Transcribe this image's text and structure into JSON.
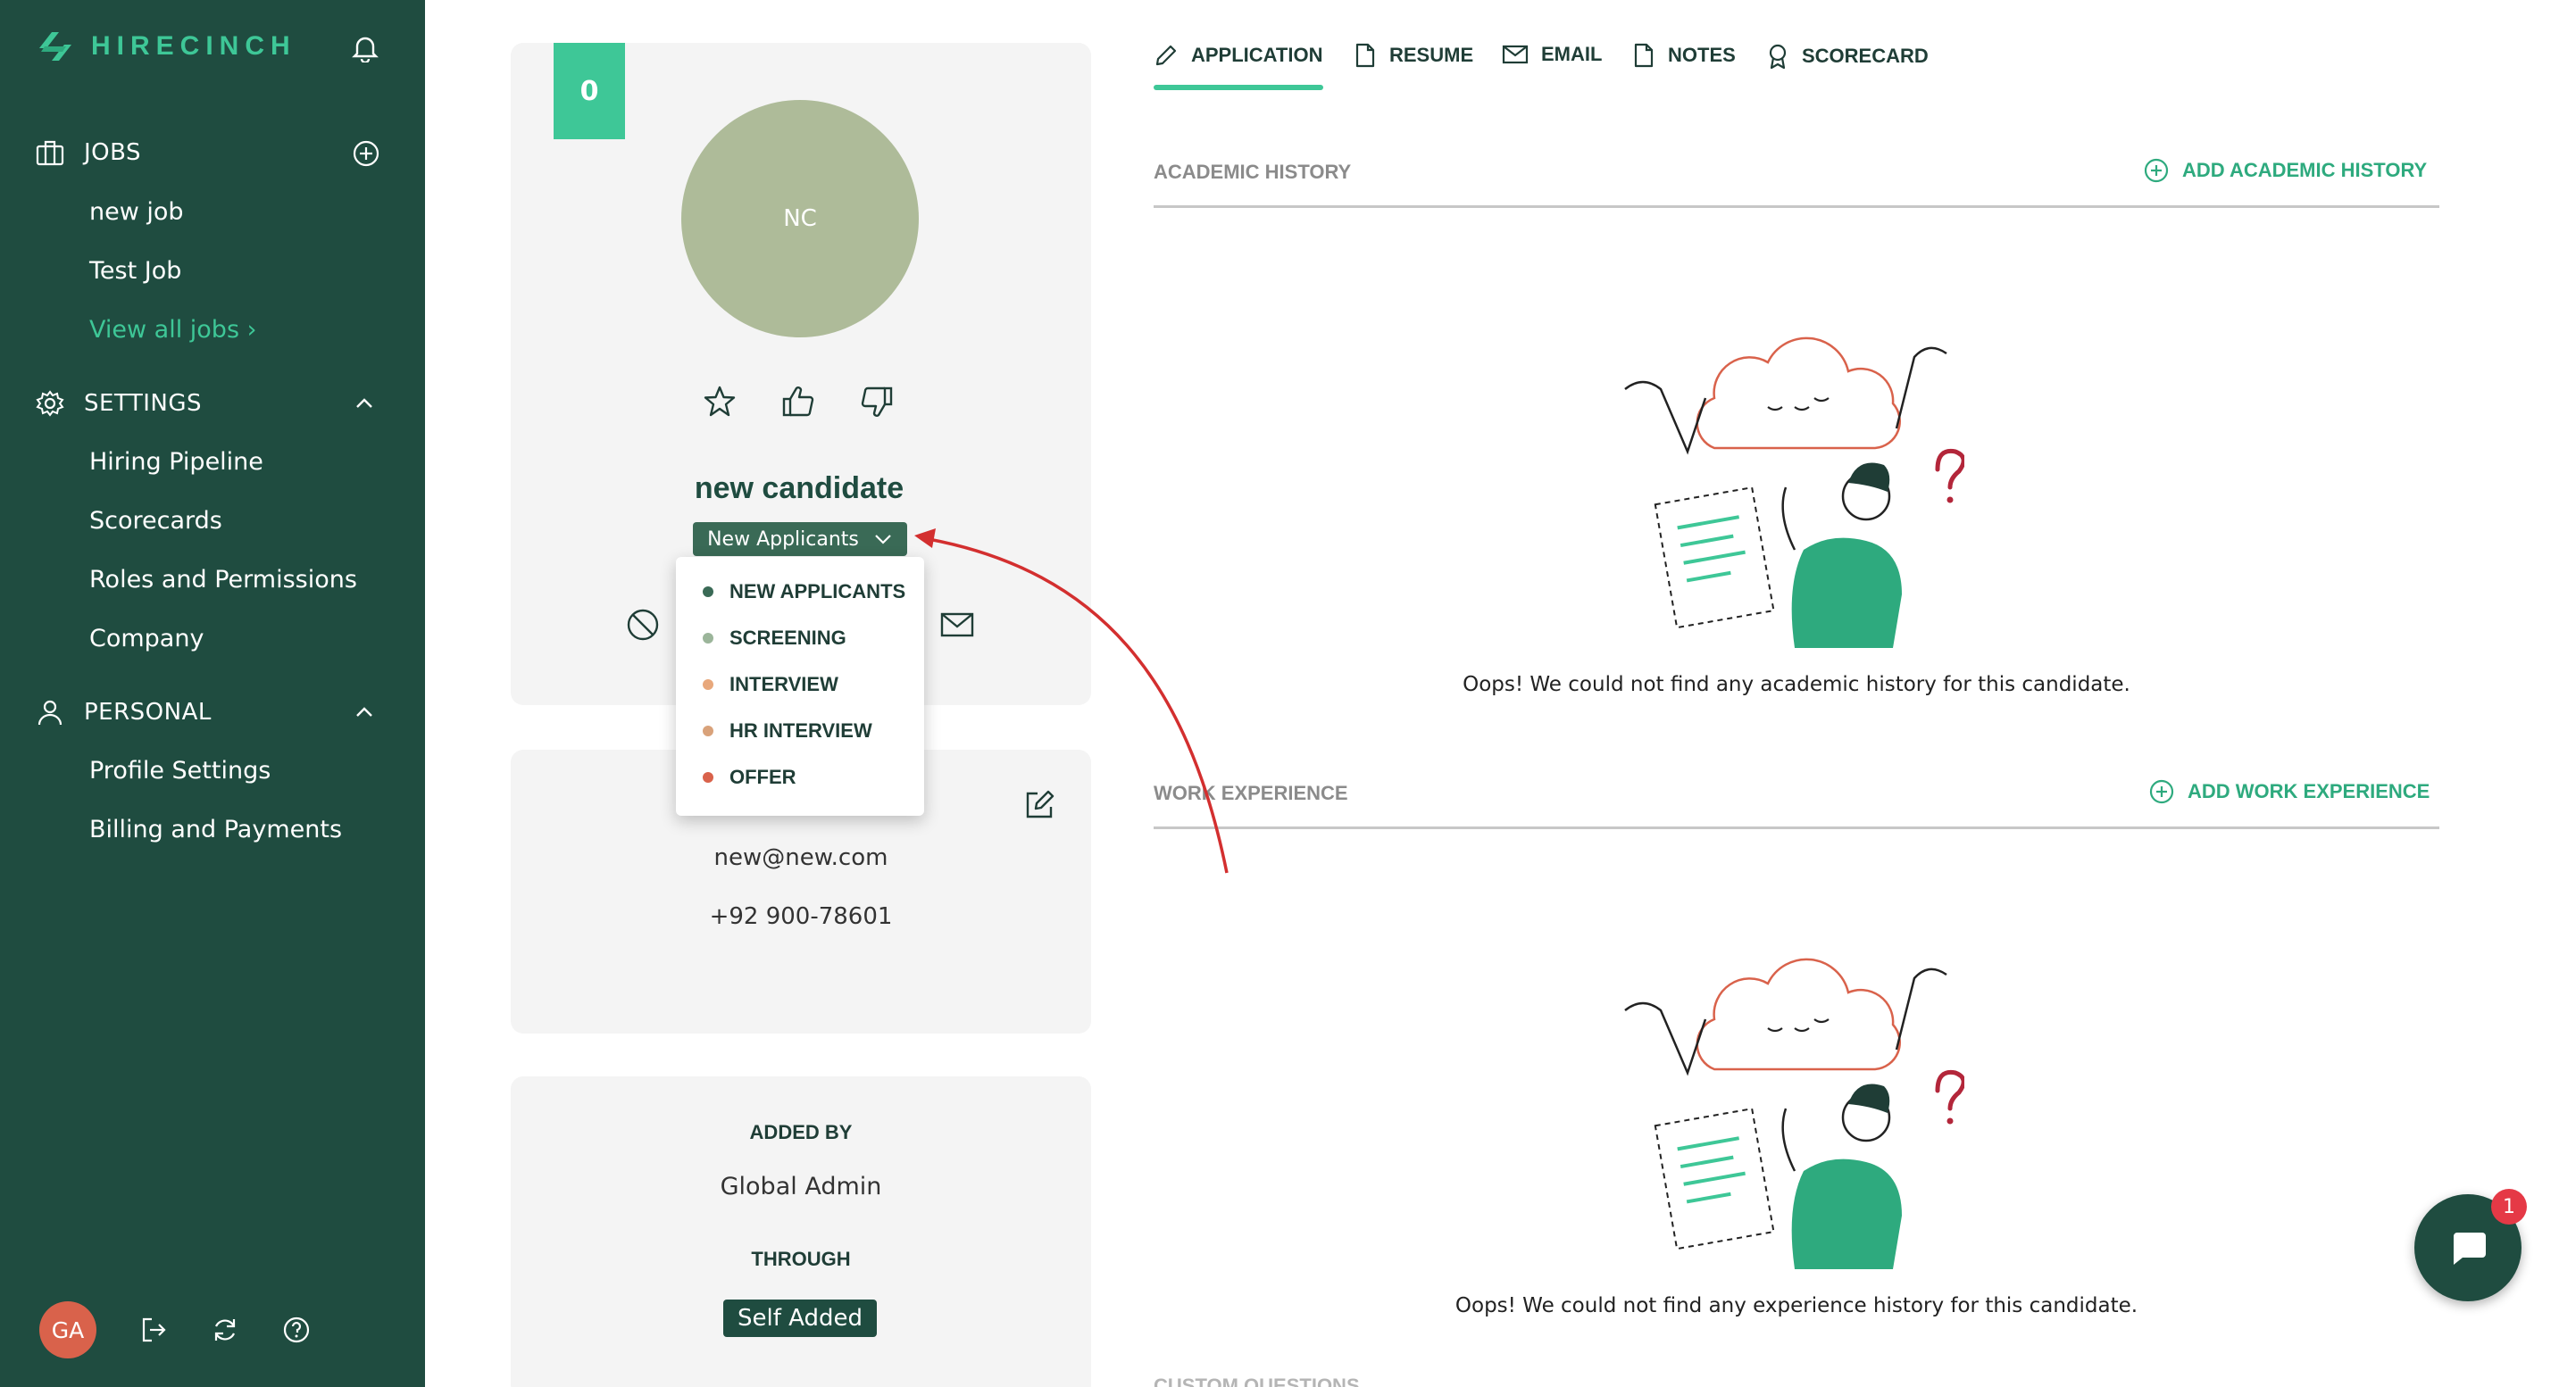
{
  "app": {
    "name": "HIRECINCH"
  },
  "sidebar": {
    "jobs": {
      "label": "JOBS",
      "items": [
        "new job",
        "Test Job"
      ],
      "view_all": "View all jobs ›"
    },
    "settings": {
      "label": "SETTINGS",
      "items": [
        "Hiring Pipeline",
        "Scorecards",
        "Roles and Permissions",
        "Company"
      ]
    },
    "personal": {
      "label": "PERSONAL",
      "items": [
        "Profile Settings",
        "Billing and Payments"
      ]
    },
    "user_initials": "GA"
  },
  "candidate": {
    "score": "0",
    "initials": "NC",
    "name": "new candidate",
    "stage": "New Applicants",
    "email": "new@new.com",
    "phone": "+92 900-78601",
    "added_by_label": "ADDED BY",
    "added_by": "Global Admin",
    "through_label": "THROUGH",
    "through": "Self Added"
  },
  "stage_dropdown": {
    "options": [
      {
        "label": "NEW APPLICANTS",
        "color": "#3a6a56"
      },
      {
        "label": "SCREENING",
        "color": "#9bb59a"
      },
      {
        "label": "INTERVIEW",
        "color": "#e8a87c"
      },
      {
        "label": "HR INTERVIEW",
        "color": "#d9a27a"
      },
      {
        "label": "OFFER",
        "color": "#d9624b"
      }
    ]
  },
  "tabs": [
    "APPLICATION",
    "RESUME",
    "EMAIL",
    "NOTES",
    "SCORECARD"
  ],
  "academic": {
    "title": "ACADEMIC HISTORY",
    "add": "ADD ACADEMIC HISTORY",
    "empty": "Oops! We could not find any academic history for this candidate."
  },
  "work": {
    "title": "WORK EXPERIENCE",
    "add": "ADD WORK EXPERIENCE",
    "empty": "Oops! We could not find any experience history for this candidate."
  },
  "next_section": "CUSTOM QUESTIONS",
  "chat": {
    "unread": "1"
  },
  "colors": {
    "sidebar": "#1f4c40",
    "accent": "#3ec797",
    "annotation_arrow": "#d32f2f"
  }
}
